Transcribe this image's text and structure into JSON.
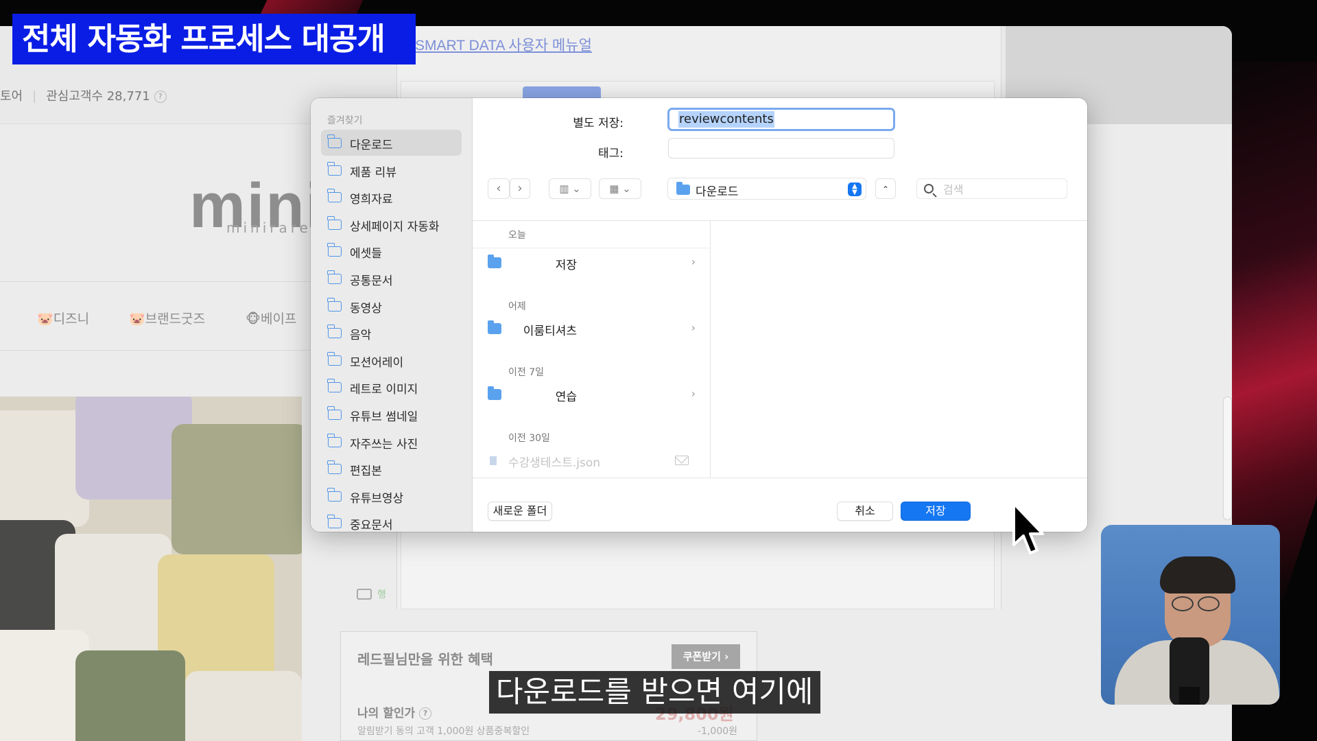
{
  "overlay": {
    "title_banner": "전체 자동화 프로세스 대공개",
    "subtitle": "다운로드를 받으면 여기에"
  },
  "webpage": {
    "stats_prefix": "토어",
    "interest_count": "관심고객수 28,771",
    "help_glyph": "?",
    "smart_data_link": "SMART DATA 사용자 메뉴얼",
    "logo_text": "minir",
    "logo_sub": "minirare r",
    "nav": [
      "🐷디즈니",
      "🐷브랜드굿즈",
      "🐵베이프"
    ],
    "card_label": "행",
    "benefit": {
      "title": "레드필님만을 위한 혜택",
      "coupon_button": "쿠폰받기 ›",
      "my_price_label": "나의 할인가",
      "help": "?",
      "price": "29,800원",
      "alarm_text": "알림받기 동의 고객 1,000원 상품중복할인",
      "minus": "-1,000원"
    }
  },
  "dialog": {
    "sidebar": {
      "heading": "즐겨찾기",
      "items": [
        {
          "label": "다운로드",
          "selected": true
        },
        {
          "label": "제품 리뷰"
        },
        {
          "label": "영희자료"
        },
        {
          "label": "상세페이지 자동화"
        },
        {
          "label": "에셋들"
        },
        {
          "label": "공통문서"
        },
        {
          "label": "동영상"
        },
        {
          "label": "음악"
        },
        {
          "label": "모션어레이"
        },
        {
          "label": "레트로 이미지"
        },
        {
          "label": "유튜브 썸네일"
        },
        {
          "label": "자주쓰는 사진"
        },
        {
          "label": "편집본"
        },
        {
          "label": "유튜브영상"
        },
        {
          "label": "중요문서"
        }
      ]
    },
    "save_as_label": "별도 저장:",
    "save_as_value": "reviewcontents",
    "tags_label": "태그:",
    "toolbar": {
      "back": "‹",
      "forward": "›",
      "view_columns": "▥ ⌄",
      "view_grid": "▦ ⌄",
      "location": "다운로드",
      "expand": "⌃",
      "search_placeholder": "검색"
    },
    "sections": [
      {
        "heading": "오늘",
        "rows": [
          {
            "type": "folder",
            "label": "저장"
          }
        ]
      },
      {
        "heading": "어제",
        "rows": [
          {
            "type": "folder",
            "label": "이룸티셔츠"
          }
        ]
      },
      {
        "heading": "이전 7일",
        "rows": [
          {
            "type": "folder",
            "label": "연습"
          }
        ]
      },
      {
        "heading": "이전 30일",
        "rows": [
          {
            "type": "file",
            "label": "수강생테스트.json"
          }
        ]
      }
    ],
    "chevron": "›",
    "new_folder": "새로운 폴더",
    "cancel": "취소",
    "save": "저장"
  },
  "colors": {
    "accent_blue": "#1677f2",
    "title_banner_bg": "#0a1de5",
    "folder_blue": "#5aa2ee"
  },
  "icons": {
    "sidebar": "folder-outline-icon",
    "list": "folder-filled-icon",
    "search": "search-icon",
    "file": "json-file-icon",
    "mail": "mail-icon",
    "cursor": "mouse-pointer-icon"
  }
}
